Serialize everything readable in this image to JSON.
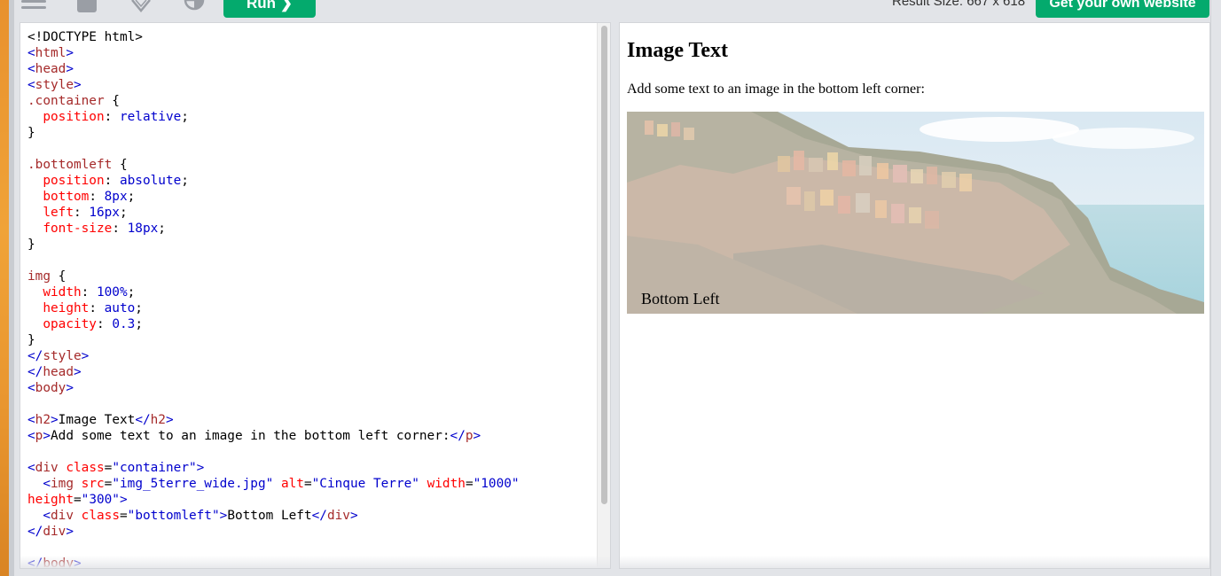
{
  "toolbar": {
    "run_label": "Run ❯",
    "result_size": "Result Size: 667 x 618",
    "get_website_label": "Get your own website",
    "icons": [
      "menu-icon",
      "square-icon",
      "rotate-icon",
      "contrast-icon"
    ]
  },
  "editor": {
    "lines": [
      "<!DOCTYPE html>",
      "<html>",
      "<head>",
      "<style>",
      ".container {",
      "  position: relative;",
      "}",
      "",
      ".bottomleft {",
      "  position: absolute;",
      "  bottom: 8px;",
      "  left: 16px;",
      "  font-size: 18px;",
      "}",
      "",
      "img {",
      "  width: 100%;",
      "  height: auto;",
      "  opacity: 0.3;",
      "}",
      "</style>",
      "</head>",
      "<body>",
      "",
      "<h2>Image Text</h2>",
      "<p>Add some text to an image in the bottom left corner:</p>",
      "",
      "<div class=\"container\">",
      "  <img src=\"img_5terre_wide.jpg\" alt=\"Cinque Terre\" width=\"1000\"",
      "height=\"300\">",
      "  <div class=\"bottomleft\">Bottom Left</div>",
      "</div>",
      "",
      "</body>"
    ]
  },
  "result": {
    "heading": "Image Text",
    "paragraph": "Add some text to an image in the bottom left corner:",
    "overlay_text": "Bottom Left"
  },
  "colors": {
    "accent": "#04aa6d",
    "tag": "#a52a2a",
    "bracket": "#0000cd",
    "property": "#ff0000",
    "value": "#0000cd"
  }
}
